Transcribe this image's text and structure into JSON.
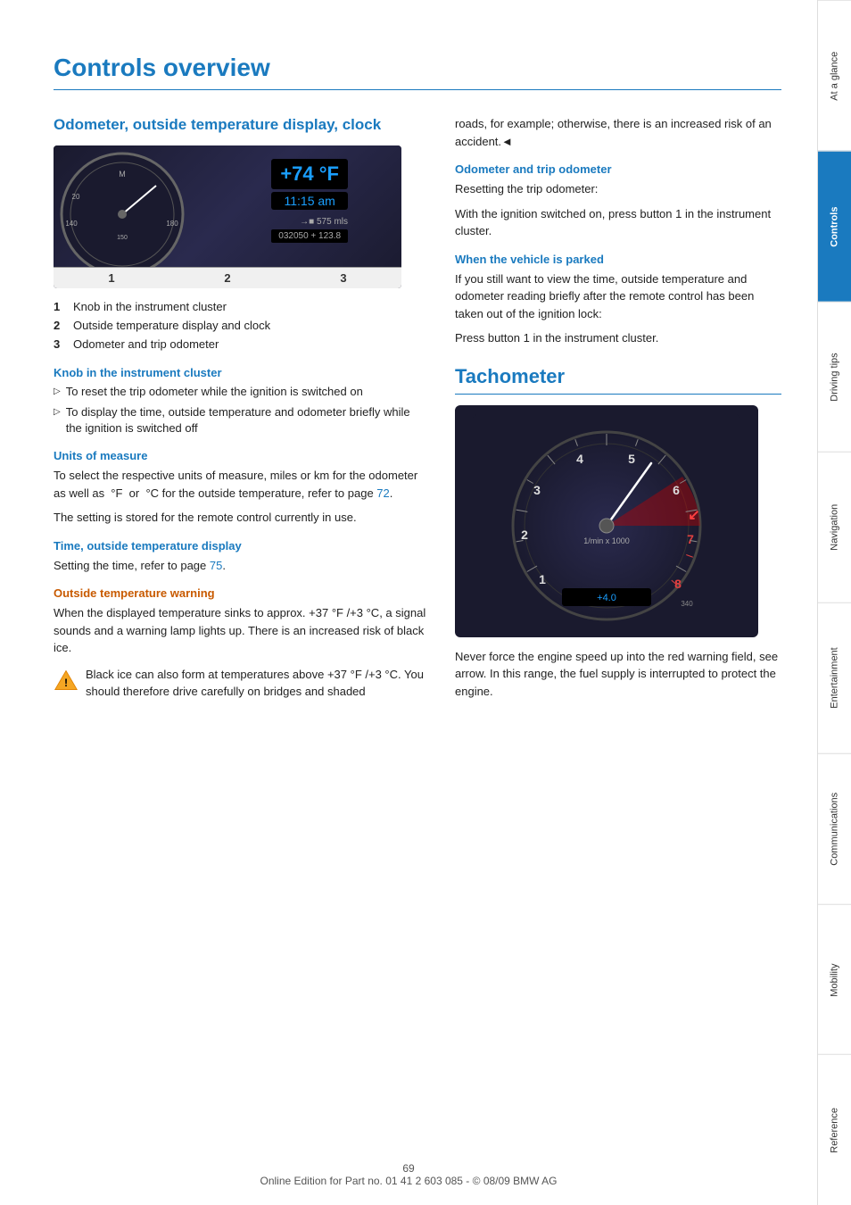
{
  "page": {
    "title": "Controls overview",
    "page_number": "69",
    "footer_text": "Online Edition for Part no. 01 41 2 603 085 - © 08/09 BMW AG"
  },
  "sidebar": {
    "items": [
      {
        "label": "At a glance",
        "active": false
      },
      {
        "label": "Controls",
        "active": true
      },
      {
        "label": "Driving tips",
        "active": false
      },
      {
        "label": "Navigation",
        "active": false
      },
      {
        "label": "Entertainment",
        "active": false
      },
      {
        "label": "Communications",
        "active": false
      },
      {
        "label": "Mobility",
        "active": false
      },
      {
        "label": "Reference",
        "active": false
      }
    ]
  },
  "left_column": {
    "section_heading": "Odometer, outside temperature display, clock",
    "cluster_display": {
      "temp": "+74 °F",
      "time": "11:15 am",
      "odometer": "575 mls",
      "odometer_trip": "032050 + 123.8"
    },
    "image_labels": [
      {
        "num": "1",
        "text": "Knob in the instrument cluster"
      },
      {
        "num": "2",
        "text": "Outside temperature display and clock"
      },
      {
        "num": "3",
        "text": "Odometer and trip odometer"
      }
    ],
    "knob_section": {
      "heading": "Knob in the instrument cluster",
      "bullets": [
        "To reset the trip odometer while the ignition is switched on",
        "To display the time, outside temperature and odometer briefly while the ignition is switched off"
      ]
    },
    "units_section": {
      "heading": "Units of measure",
      "text": "To select the respective units of measure, miles or km for the odometer as well as  °F  or  °C for the outside temperature, refer to page 72.",
      "text2": "The setting is stored for the remote control currently in use."
    },
    "time_section": {
      "heading": "Time, outside temperature display",
      "text": "Setting the time, refer to page 75."
    },
    "warning_section": {
      "heading": "Outside temperature warning",
      "text": "When the displayed temperature sinks to approx. +37 °F /+3 °C, a signal sounds and a warning lamp lights up. There is an increased risk of black ice.",
      "warning_box_text": "Black ice can also form at temperatures above +37 °F /+3 °C. You should therefore drive carefully on bridges and shaded"
    }
  },
  "right_column": {
    "continued_text": "roads, for example; otherwise, there is an increased risk of an accident.◄",
    "odometer_section": {
      "heading": "Odometer and trip odometer",
      "text": "Resetting the trip odometer:",
      "text2": "With the ignition switched on, press button 1 in the instrument cluster."
    },
    "parked_section": {
      "heading": "When the vehicle is parked",
      "text": "If you still want to view the time, outside temperature and odometer reading briefly after the remote control has been taken out of the ignition lock:",
      "text2": "Press button 1 in the instrument cluster."
    },
    "tachometer_section": {
      "heading": "Tachometer",
      "description": "Never force the engine speed up into the red warning field, see arrow. In this range, the fuel supply is interrupted to protect the engine."
    }
  }
}
